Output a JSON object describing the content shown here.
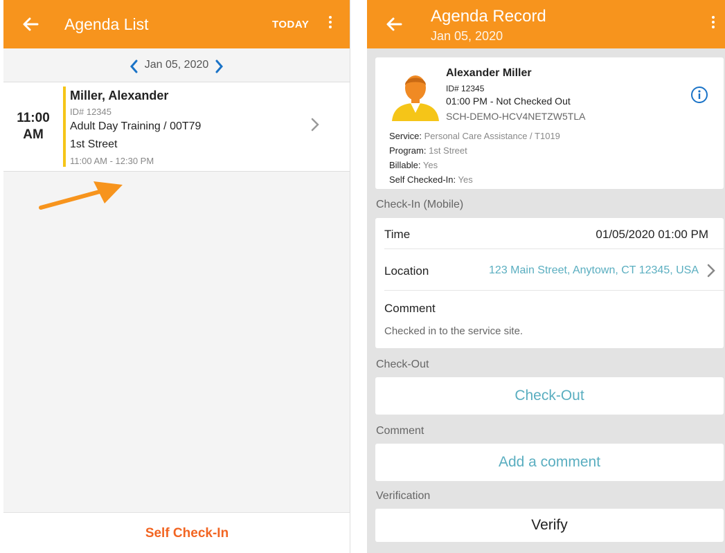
{
  "left": {
    "appbar": {
      "back_icon": "arrow-left-icon",
      "title": "Agenda List",
      "today_label": "TODAY",
      "more_icon": "more-vert-icon"
    },
    "datebar": {
      "prev_icon": "chevron-left-icon",
      "date": "Jan 05, 2020",
      "next_icon": "chevron-right-icon"
    },
    "agenda_item": {
      "time_hour": "11:00",
      "time_ampm": "AM",
      "name": "Miller, Alexander",
      "id": "ID# 12345",
      "service": "Adult Day Training / 00T79",
      "location": "1st Street",
      "time_range": "11:00 AM - 12:30 PM"
    },
    "bottombar": {
      "self_checkin_label": "Self Check-In"
    },
    "colors": {
      "accent": "#f7941d",
      "item_bar": "#f5c518",
      "arrow": "#f7941d",
      "self_checkin": "#f26522"
    }
  },
  "right": {
    "appbar": {
      "back_icon": "arrow-left-icon",
      "title": "Agenda Record",
      "subtitle": "Jan 05, 2020",
      "more_icon": "more-vert-icon"
    },
    "profile": {
      "avatar_icon": "person-avatar-icon",
      "name": "Alexander Miller",
      "id": "ID# 12345",
      "status": "01:00 PM - Not Checked Out",
      "code": "SCH-DEMO-HCV4NETZW5TLA",
      "info_icon": "info-icon",
      "service_label": "Service:",
      "service_value": "Personal Care Assistance / T1019",
      "program_label": "Program:",
      "program_value": "1st Street",
      "billable_label": "Billable:",
      "billable_value": "Yes",
      "self_checked_label": "Self Checked-In:",
      "self_checked_value": "Yes"
    },
    "checkin": {
      "section_label": "Check-In (Mobile)",
      "time_label": "Time",
      "time_value": "01/05/2020 01:00 PM",
      "location_label": "Location",
      "location_value": "123 Main Street, Anytown, CT 12345, USA",
      "comment_label": "Comment",
      "comment_value": "Checked in to the service site."
    },
    "checkout": {
      "section_label": "Check-Out",
      "button_label": "Check-Out"
    },
    "comment": {
      "section_label": "Comment",
      "button_label": "Add a comment"
    },
    "verification": {
      "section_label": "Verification",
      "button_label": "Verify"
    },
    "colors": {
      "link": "#5aaec0",
      "info": "#1a73c7"
    }
  }
}
